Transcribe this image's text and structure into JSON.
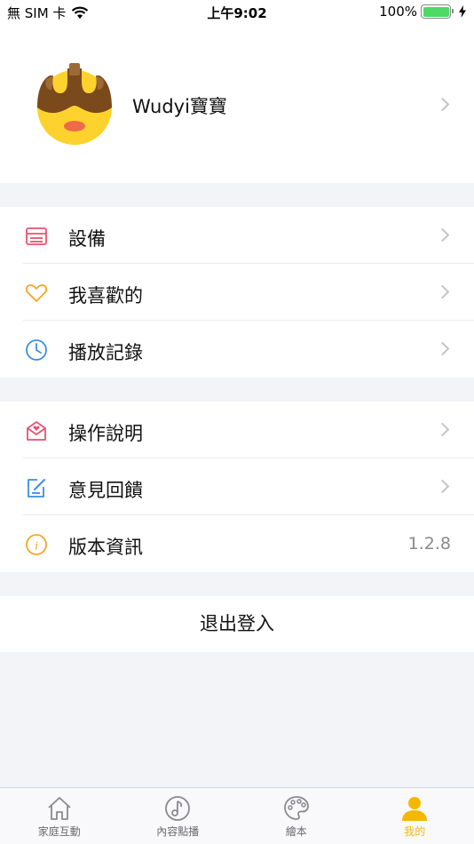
{
  "status_bar": {
    "carrier": "無 SIM 卡",
    "time": "上午9:02",
    "battery": "100%",
    "icons": [
      "wifi-icon",
      "battery-icon",
      "charging-icon"
    ]
  },
  "profile": {
    "name": "Wudyi寶寶",
    "avatar_icon": "wudyi-avatar-icon"
  },
  "menu_group_1": [
    {
      "label": "設備",
      "icon": "device-icon",
      "color": "#e8536e"
    },
    {
      "label": "我喜歡的",
      "icon": "heart-icon",
      "color": "#f5a623"
    },
    {
      "label": "播放記錄",
      "icon": "clock-icon",
      "color": "#3a8ee6"
    }
  ],
  "menu_group_2": [
    {
      "label": "操作說明",
      "icon": "mail-heart-icon",
      "color": "#e8536e"
    },
    {
      "label": "意見回饋",
      "icon": "edit-icon",
      "color": "#3a8ee6"
    },
    {
      "label": "版本資訊",
      "icon": "info-icon",
      "color": "#f5a623",
      "value": "1.2.8"
    }
  ],
  "logout_label": "退出登入",
  "tabs": [
    {
      "label": "家庭互動",
      "icon": "home-icon"
    },
    {
      "label": "內容點播",
      "icon": "music-note-icon"
    },
    {
      "label": "繪本",
      "icon": "palette-icon"
    },
    {
      "label": "我的",
      "icon": "person-icon",
      "active": true
    }
  ],
  "colors": {
    "accent": "#f5b800",
    "background": "#f3f4f8"
  }
}
